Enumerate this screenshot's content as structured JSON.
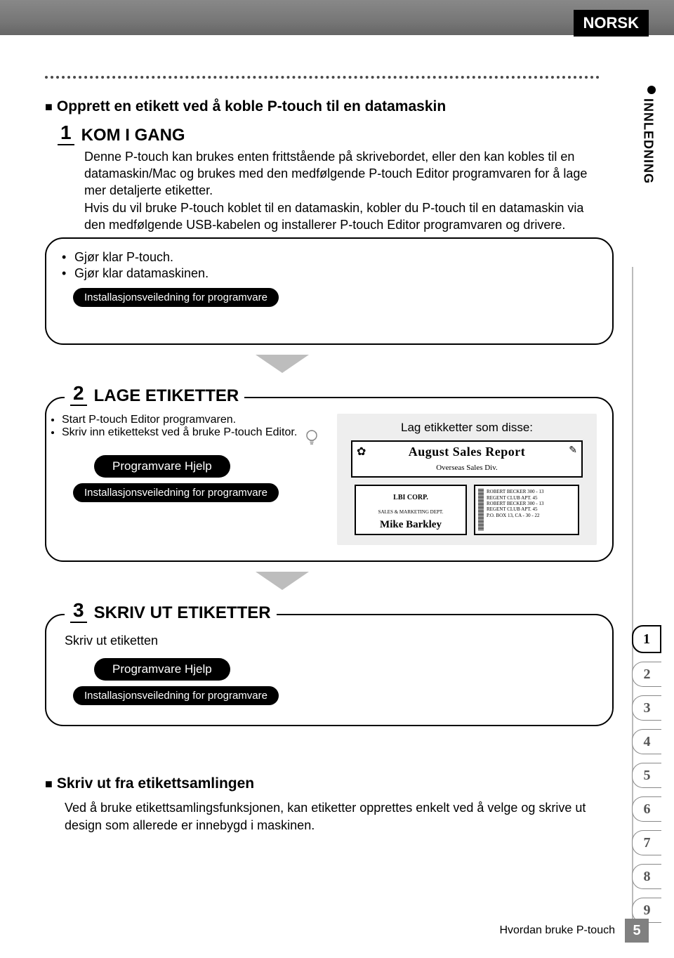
{
  "header": {
    "language": "NORSK"
  },
  "side_tab": "INNLEDNING",
  "intro_heading": "Opprett en etikett ved å koble P-touch til en datamaskin",
  "step1": {
    "num": "1",
    "title": "KOM I GANG",
    "para": "Denne P-touch kan brukes enten frittstående på skrivebordet, eller den kan kobles til en datamaskin/Mac og brukes med den medfølgende P-touch Editor programvaren for å lage mer detaljerte etiketter.\nHvis du vil bruke P-touch koblet til en datamaskin, kobler du P-touch til en datamaskin via den medfølgende USB-kabelen og installerer P-touch Editor programvaren og drivere.",
    "bullets": [
      "Gjør klar P-touch.",
      "Gjør klar datamaskinen."
    ],
    "pill": "Installasjonsveiledning for programvare"
  },
  "step2": {
    "num": "2",
    "title": "LAGE ETIKETTER",
    "bullets": [
      "Start P-touch Editor programvaren.",
      "Skriv inn etikettekst ved å bruke P-touch Editor."
    ],
    "pill1": "Programvare Hjelp",
    "pill2": "Installasjonsveiledning for programvare",
    "callout": "Lag etikketter som disse:",
    "sample1": {
      "line1": "August Sales Report",
      "line2": "Overseas Sales Div."
    },
    "sample2": {
      "line1": "LBI CORP.",
      "line2": "SALES & MARKETING DEPT.",
      "line3": "Mike Barkley"
    },
    "sample3": [
      "ROBERT BECKER 300 - 13",
      "REGENT CLUB APT. 45",
      "ROBERT BECKER 300 - 13",
      "REGENT CLUB APT. 45",
      "P.O. BOX 13, CA - 30 - 22"
    ]
  },
  "step3": {
    "num": "3",
    "title": "SKRIV UT ETIKETTER",
    "text": "Skriv ut etiketten",
    "pill1": "Programvare Hjelp",
    "pill2": "Installasjonsveiledning for programvare"
  },
  "bottom": {
    "title": "Skriv ut fra etikettsamlingen",
    "para": "Ved å bruke etikettsamlingsfunksjonen, kan etiketter opprettes enkelt ved å velge og skrive ut design som allerede er innebygd i maskinen."
  },
  "index": [
    "1",
    "2",
    "3",
    "4",
    "5",
    "6",
    "7",
    "8",
    "9"
  ],
  "footer": {
    "text": "Hvordan bruke P-touch",
    "page": "5"
  }
}
